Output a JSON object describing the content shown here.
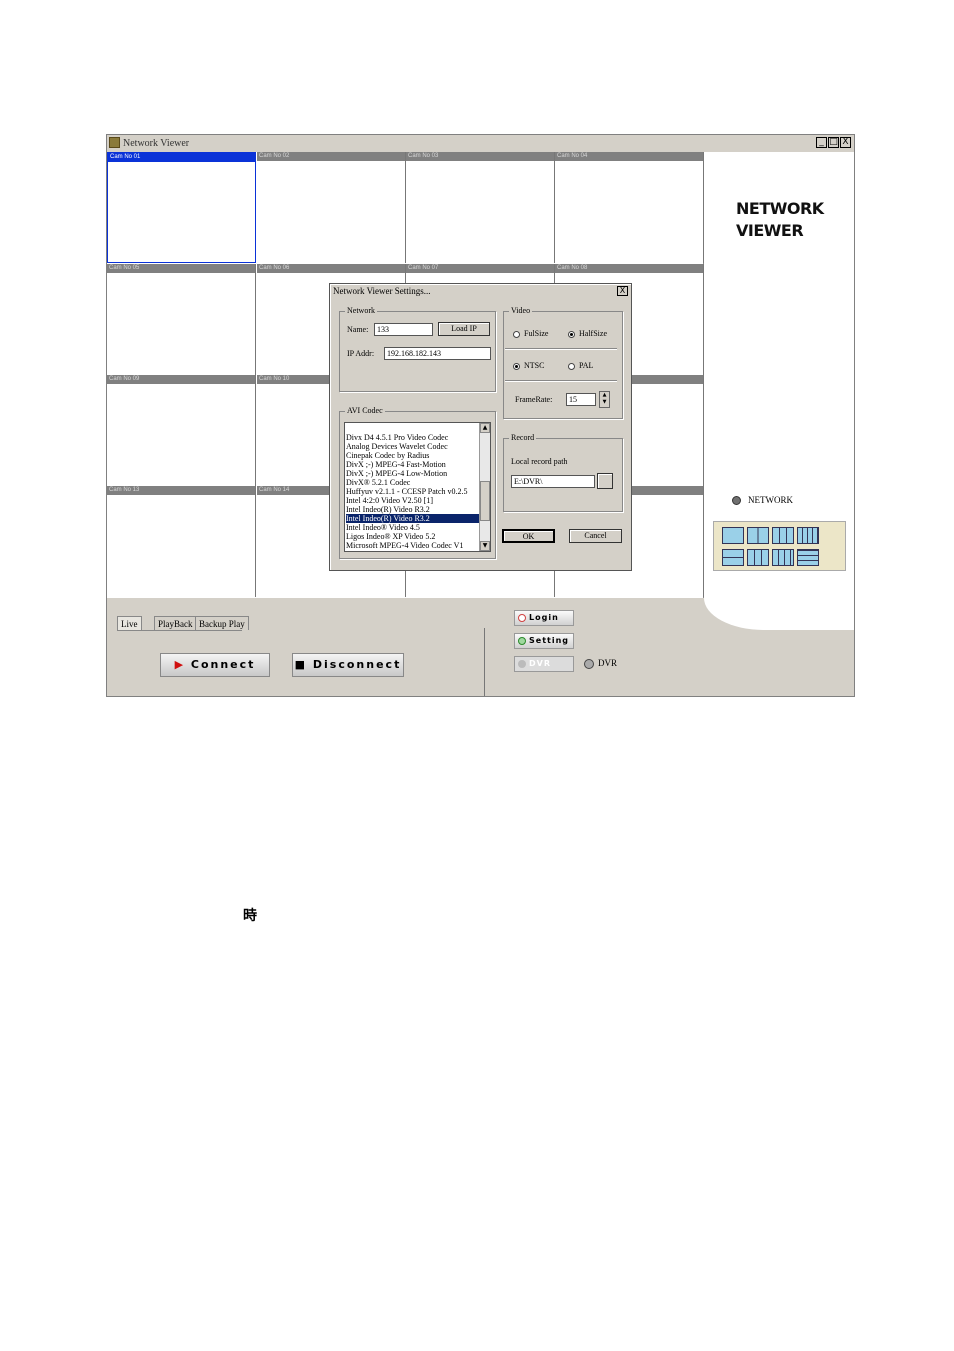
{
  "window": {
    "title": "Network Viewer",
    "controls": [
      "_",
      "□",
      "X"
    ]
  },
  "cameras": [
    {
      "label": "Cam No 01",
      "active": true
    },
    {
      "label": "Cam No 02"
    },
    {
      "label": "Cam No 03"
    },
    {
      "label": "Cam No 04"
    },
    {
      "label": "Cam No 05"
    },
    {
      "label": "Cam No 06"
    },
    {
      "label": "Cam No 07"
    },
    {
      "label": "Cam No 08"
    },
    {
      "label": "Cam No 09"
    },
    {
      "label": "Cam No 10"
    },
    {
      "label": "Cam No 13"
    },
    {
      "label": "Cam No 14"
    }
  ],
  "brand": {
    "line1": "NETWORK",
    "line2": "VIEWER"
  },
  "network_indicator": {
    "label": "NETWORK"
  },
  "tabs": [
    {
      "label": "Live",
      "selected": true
    },
    {
      "label": "PlayBack"
    },
    {
      "label": "Backup Play"
    }
  ],
  "buttons": {
    "connect": "Connect",
    "disconnect": "Disconnect",
    "login": "Login",
    "setting": "Setting",
    "dvr": "DVR"
  },
  "dvr_indicator": {
    "label": "DVR"
  },
  "dialog": {
    "title": "Network Viewer Settings...",
    "close": "X",
    "network": {
      "group_label": "Network",
      "name_label": "Name:",
      "name_value": "133",
      "load_ip": "Load IP",
      "ip_label": "IP Addr:",
      "ip_value": "192.168.182.143"
    },
    "codec": {
      "group_label": "AVI Codec",
      "items": [
        "Divx D4 4.5.1 Pro Video Codec",
        "Analog Devices Wavelet Codec",
        "Cinepak Codec by Radius",
        "DivX ;-) MPEG-4 Fast-Motion",
        "DivX ;-) MPEG-4 Low-Motion",
        "DivX® 5.2.1 Codec",
        "Huffyuv v2.1.1 - CCESP Patch v0.2.5",
        "Intel 4:2:0 Video V2.50 [1]",
        "Intel Indeo(R) Video R3.2",
        "Intel Indeo(R) Video R3.2",
        "Intel Indeo® Video 4.5",
        "Ligos Indeo® XP Video 5.2",
        "Microsoft MPEG-4 Video Codec V1"
      ],
      "selected_index": 9
    },
    "video": {
      "group_label": "Video",
      "size_full": "FulSize",
      "size_half": "HalfSize",
      "size_selected": "HalfSize",
      "std_ntsc": "NTSC",
      "std_pal": "PAL",
      "std_selected": "NTSC",
      "frame_label": "FrameRate:",
      "frame_value": "15"
    },
    "record": {
      "group_label": "Record",
      "path_label": "Local record path",
      "path_value": "E:\\DVR\\",
      "browse": ""
    },
    "ok": "OK",
    "cancel": "Cancel"
  },
  "footer_text": "時"
}
